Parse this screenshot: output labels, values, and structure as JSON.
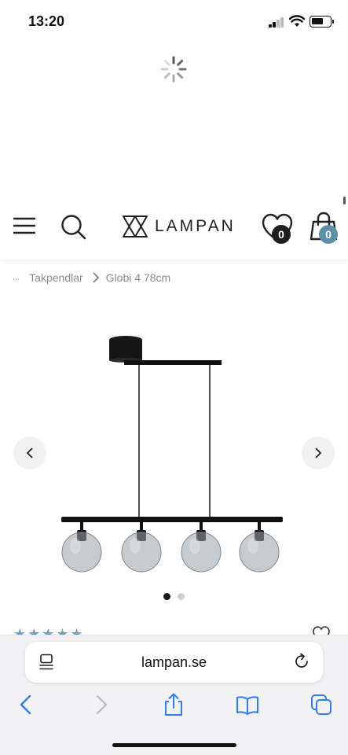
{
  "status_bar": {
    "time": "13:20"
  },
  "header": {
    "logo_text": "LAMPAN",
    "favorites_count": "0",
    "cart_count": "0"
  },
  "breadcrumb": {
    "ellipsis": "...",
    "items": [
      "Takpendlar",
      "Globi 4 78cm"
    ]
  },
  "product": {
    "gallery_dots": 2,
    "active_dot": 0
  },
  "browser": {
    "url": "lampan.se"
  },
  "colors": {
    "accent": "#5e8fa8",
    "badge_dark": "#1e1e1e",
    "stars": "#7a9ab0",
    "ios_blue": "#2f7cf6"
  }
}
